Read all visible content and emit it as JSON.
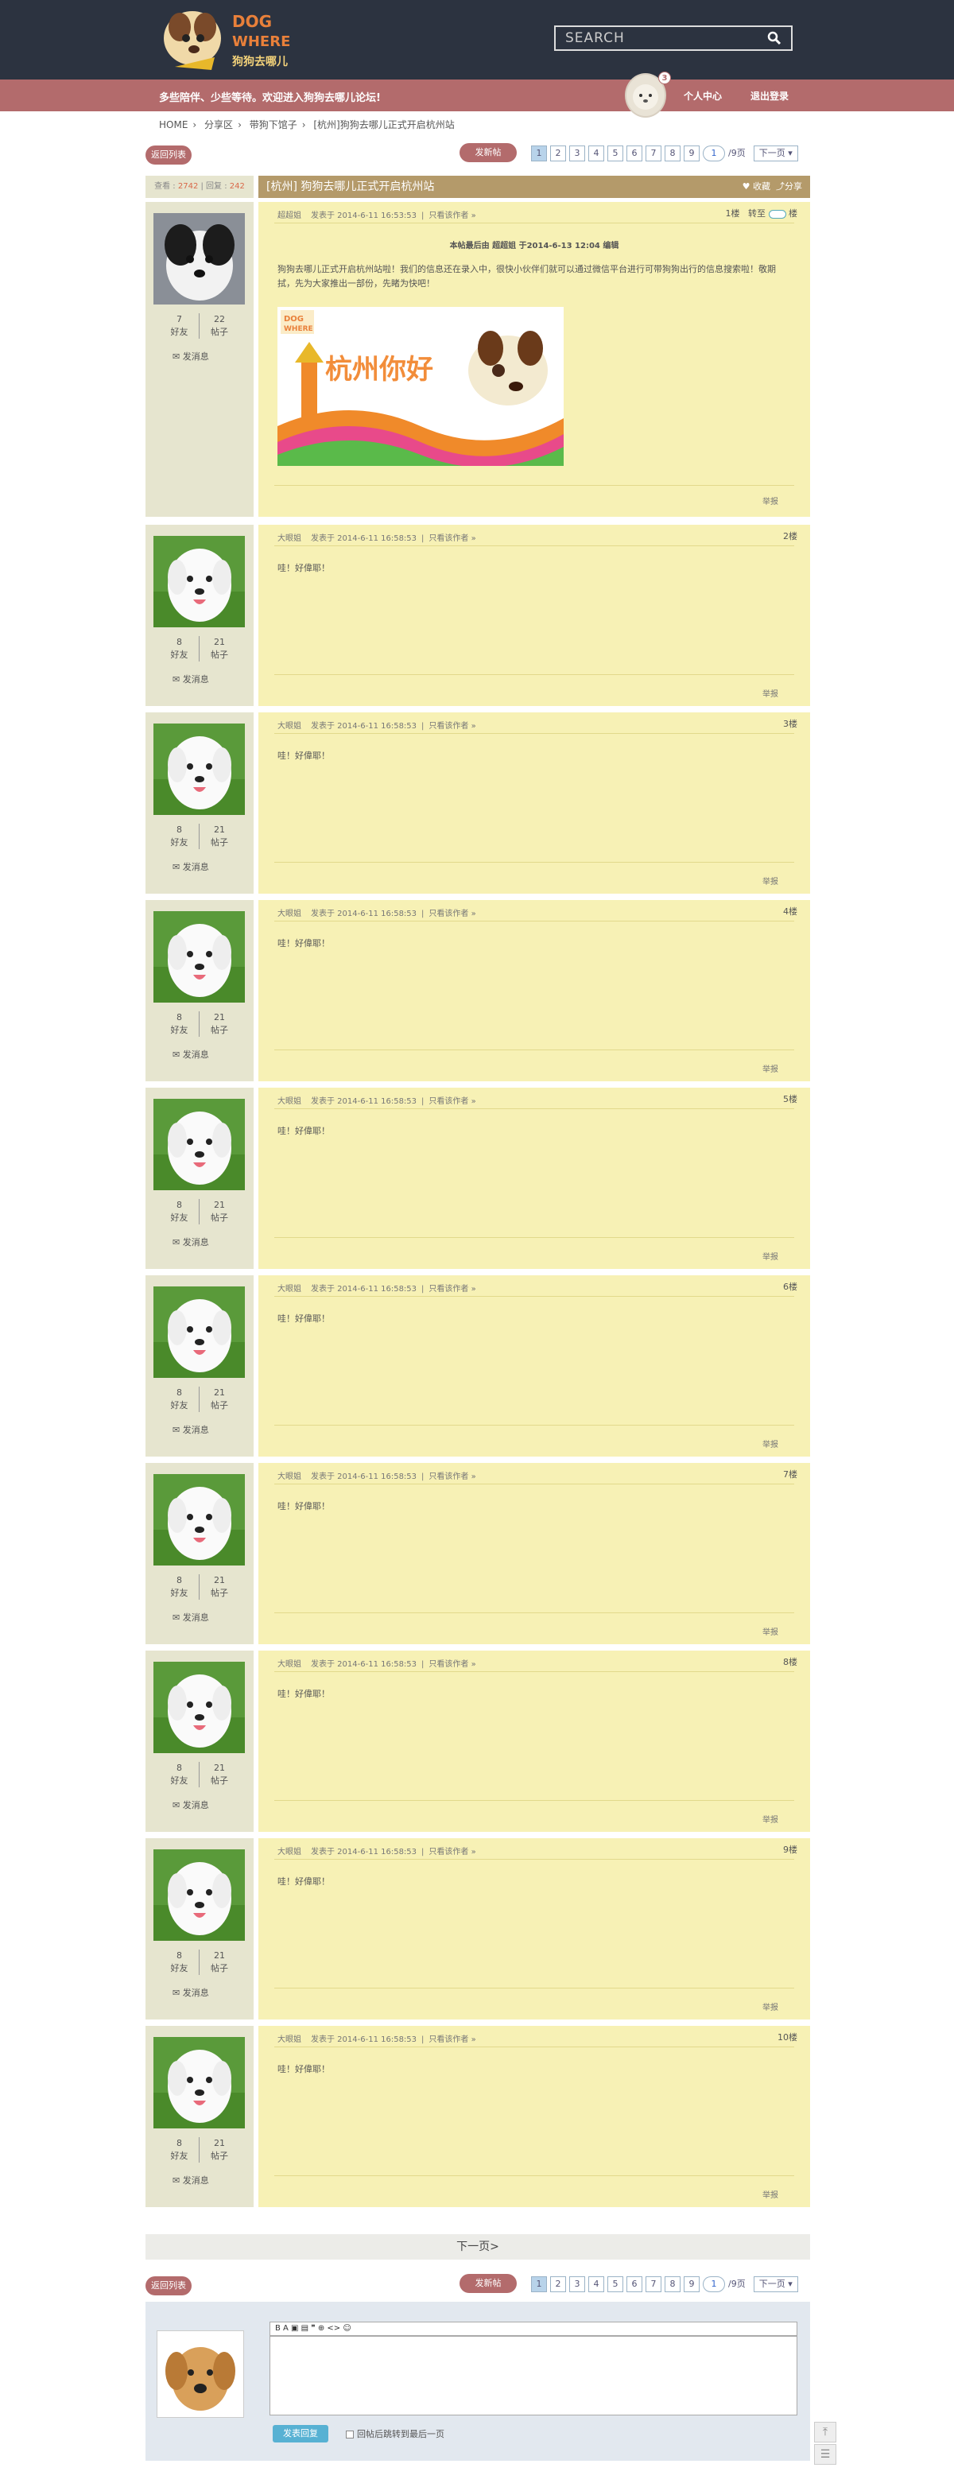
{
  "search": {
    "placeholder": "SEARCH"
  },
  "logo": {
    "line1": "DOG",
    "line2": "WHERE",
    "line3": "狗狗去哪儿"
  },
  "nav": {
    "welcome": "多些陪伴、少些等待。欢迎进入狗狗去哪儿论坛!",
    "badge": "3",
    "profile": "个人中心",
    "logout": "退出登录"
  },
  "breadcrumb": [
    "HOME",
    "分享区",
    "带狗下馆子",
    "[杭州]狗狗去哪儿正式开启杭州站"
  ],
  "buttons": {
    "back": "返回列表",
    "new_post": "发新帖",
    "next_page": "下一页 ▾",
    "next_bottom": "下一页>"
  },
  "pager": {
    "pages": [
      "1",
      "2",
      "3",
      "4",
      "5",
      "6",
      "7",
      "8",
      "9"
    ],
    "current": "1",
    "total": "/9页"
  },
  "stats": {
    "views_label": "查看 : ",
    "views": "2742",
    "sep": " | ",
    "replies_label": "回复 : ",
    "replies": "242"
  },
  "thread": {
    "title": "[杭州] 狗狗去哪儿正式开启杭州站",
    "fav": "收藏",
    "share": "分享"
  },
  "first_post": {
    "author": "超超姐",
    "time": "发表于 2014-6-11 16:53:53",
    "only": "只看该作者 »",
    "floor": "1楼",
    "jump": "转至",
    "floor_unit": "楼",
    "edit_note": "本帖最后由 超超姐 于2014-6-13 12:04 编辑",
    "content": "狗狗去哪儿正式开启杭州站啦！我们的信息还在录入中，很快小伙伴们就可以通过微信平台进行可带狗狗出行的信息搜索啦！敬期拭，先为大家推出一部份，先睹为快吧！",
    "image_text": "杭州你好",
    "report": "举报",
    "friends": "7",
    "posts": "22",
    "friends_label": "好友",
    "posts_label": "帖子",
    "msg": "发消息"
  },
  "replies": [
    {
      "author": "大眼姐",
      "time": "发表于 2014-6-11 16:58:53",
      "only": "只看该作者 »",
      "floor": "2楼",
      "content": "哇！好偉耶！",
      "report": "举报",
      "friends": "8",
      "posts": "21"
    },
    {
      "author": "大眼姐",
      "time": "发表于 2014-6-11 16:58:53",
      "only": "只看该作者 »",
      "floor": "3楼",
      "content": "哇！好偉耶！",
      "report": "举报",
      "friends": "8",
      "posts": "21"
    },
    {
      "author": "大眼姐",
      "time": "发表于 2014-6-11 16:58:53",
      "only": "只看该作者 »",
      "floor": "4楼",
      "content": "哇！好偉耶！",
      "report": "举报",
      "friends": "8",
      "posts": "21"
    },
    {
      "author": "大眼姐",
      "time": "发表于 2014-6-11 16:58:53",
      "only": "只看该作者 »",
      "floor": "5楼",
      "content": "哇！好偉耶！",
      "report": "举报",
      "friends": "8",
      "posts": "21"
    },
    {
      "author": "大眼姐",
      "time": "发表于 2014-6-11 16:58:53",
      "only": "只看该作者 »",
      "floor": "6楼",
      "content": "哇！好偉耶！",
      "report": "举报",
      "friends": "8",
      "posts": "21"
    },
    {
      "author": "大眼姐",
      "time": "发表于 2014-6-11 16:58:53",
      "only": "只看该作者 »",
      "floor": "7楼",
      "content": "哇！好偉耶！",
      "report": "举报",
      "friends": "8",
      "posts": "21"
    },
    {
      "author": "大眼姐",
      "time": "发表于 2014-6-11 16:58:53",
      "only": "只看该作者 »",
      "floor": "8楼",
      "content": "哇！好偉耶！",
      "report": "举报",
      "friends": "8",
      "posts": "21"
    },
    {
      "author": "大眼姐",
      "time": "发表于 2014-6-11 16:58:53",
      "only": "只看该作者 »",
      "floor": "9楼",
      "content": "哇！好偉耶！",
      "report": "举报",
      "friends": "8",
      "posts": "21"
    },
    {
      "author": "大眼姐",
      "time": "发表于 2014-6-11 16:58:53",
      "only": "只看该作者 »",
      "floor": "10楼",
      "content": "哇！好偉耶！",
      "report": "举报",
      "friends": "8",
      "posts": "21"
    }
  ],
  "labels": {
    "friends": "好友",
    "posts": "帖子",
    "msg": "发消息"
  },
  "editor": {
    "tools": "B  A  ▣  ▤  ❞  ⊕  <>  ☺",
    "submit": "发表回复",
    "checkbox": "回帖后跳转到最后一页"
  }
}
